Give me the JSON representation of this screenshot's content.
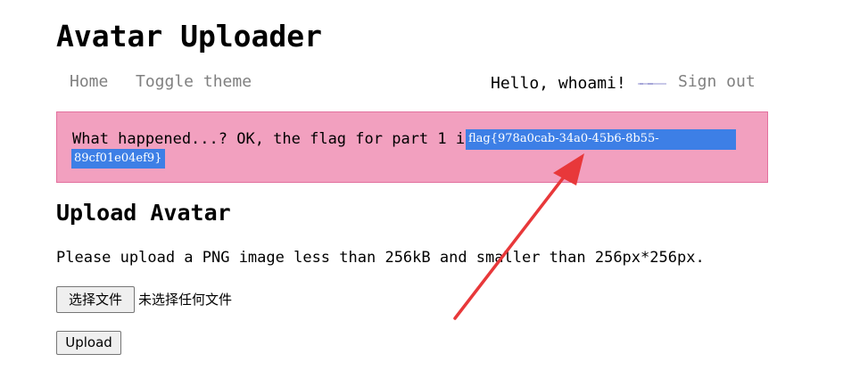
{
  "header": {
    "title": "Avatar Uploader"
  },
  "nav": {
    "home": "Home",
    "toggle_theme": "Toggle theme",
    "greeting": "Hello, whoami!",
    "avatar_alt": "avatar",
    "sign_out": "Sign out"
  },
  "alert": {
    "message": "What happened...? OK, the flag for part 1 is:",
    "flag": "flag{978a0cab-34a0-45b6-8b55-89cf01e04ef9}",
    "flag_line_1": "flag{978a0cab-34a0-45b6-8b55-",
    "flag_line_2": "89cf01e04ef9}",
    "background_color": "#f2a0bf",
    "selection_color": "#3d7fe6"
  },
  "upload": {
    "title": "Upload Avatar",
    "instructions": "Please upload a PNG image less than 256kB and smaller than 256px*256px.",
    "choose_file_label": "选择文件",
    "file_status": "未选择任何文件",
    "submit_label": "Upload"
  },
  "annotation": {
    "icon": "red-arrow-icon",
    "color": "#e8383a"
  }
}
